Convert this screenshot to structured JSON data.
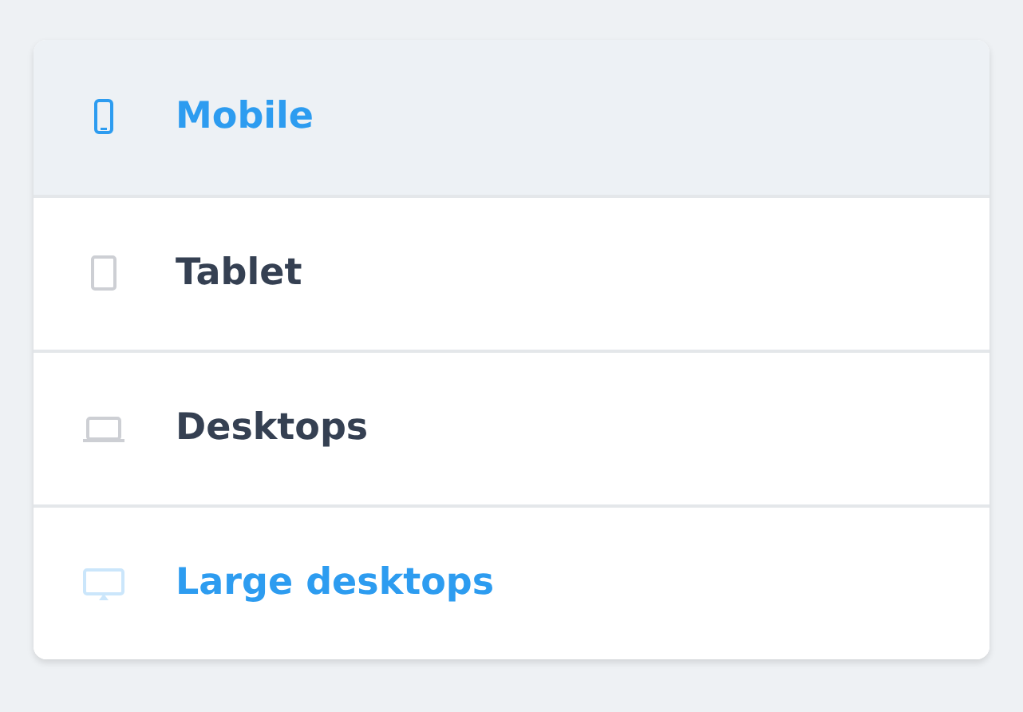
{
  "devices": [
    {
      "kind": "mobile",
      "label": "Mobile",
      "selected": true,
      "color": "#2d9cf0"
    },
    {
      "kind": "tablet",
      "label": "Tablet",
      "selected": false,
      "color": "#354052"
    },
    {
      "kind": "desktop",
      "label": "Desktops",
      "selected": false,
      "color": "#354052"
    },
    {
      "kind": "monitor",
      "label": "Large desktops",
      "selected": false,
      "color": "#2d9cf0"
    }
  ]
}
